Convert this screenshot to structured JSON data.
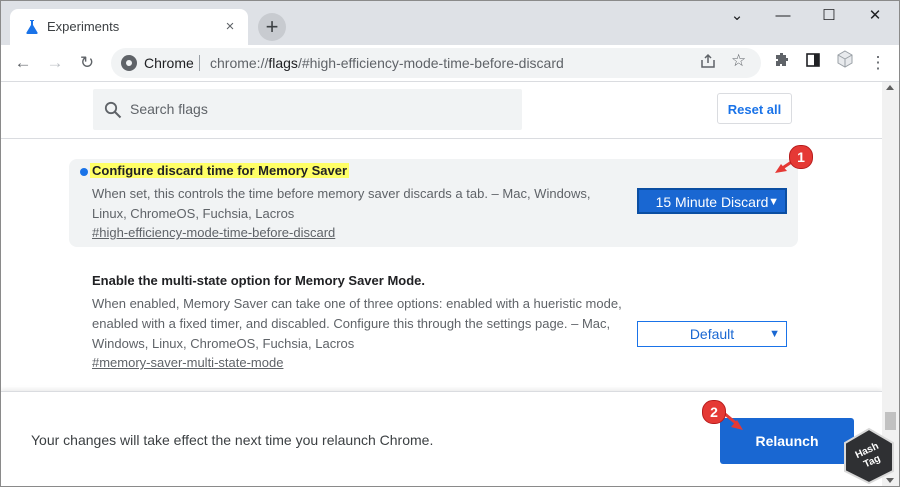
{
  "tab": {
    "title": "Experiments",
    "close": "×"
  },
  "newtab": "+",
  "window_controls": {
    "dropdown": "⌄",
    "minimize": "—",
    "maximize": "☐",
    "close": "✕"
  },
  "toolbar": {
    "back": "←",
    "forward": "→",
    "reload": "↻"
  },
  "omnibox": {
    "site_label": "Chrome",
    "url_prefix": "chrome://",
    "url_host": "flags",
    "url_path": "/#high-efficiency-mode-time-before-discard"
  },
  "search": {
    "placeholder": "Search flags"
  },
  "reset_label": "Reset all",
  "flags": [
    {
      "title": "Configure discard time for Memory Saver",
      "description": "When set, this controls the time before memory saver discards a tab. – Mac, Windows, Linux, ChromeOS, Fuchsia, Lacros",
      "link": "#high-efficiency-mode-time-before-discard",
      "selected": "15 Minute Discard"
    },
    {
      "title": "Enable the multi-state option for Memory Saver Mode.",
      "description": "When enabled, Memory Saver can take one of three options: enabled with a hueristic mode, enabled with a fixed timer, and discabled. Configure this through the settings page. – Mac, Windows, Linux, ChromeOS, Fuchsia, Lacros",
      "link": "#memory-saver-multi-state-mode",
      "selected": "Default"
    }
  ],
  "footer": {
    "message": "Your changes will take effect the next time you relaunch Chrome.",
    "relaunch_label": "Relaunch"
  },
  "annotations": {
    "badge1": "1",
    "badge2": "2"
  },
  "watermark": {
    "text": "HashTag"
  },
  "colors": {
    "accent": "#1a73e8",
    "highlight": "#ffff66",
    "badge": "#e53935"
  }
}
